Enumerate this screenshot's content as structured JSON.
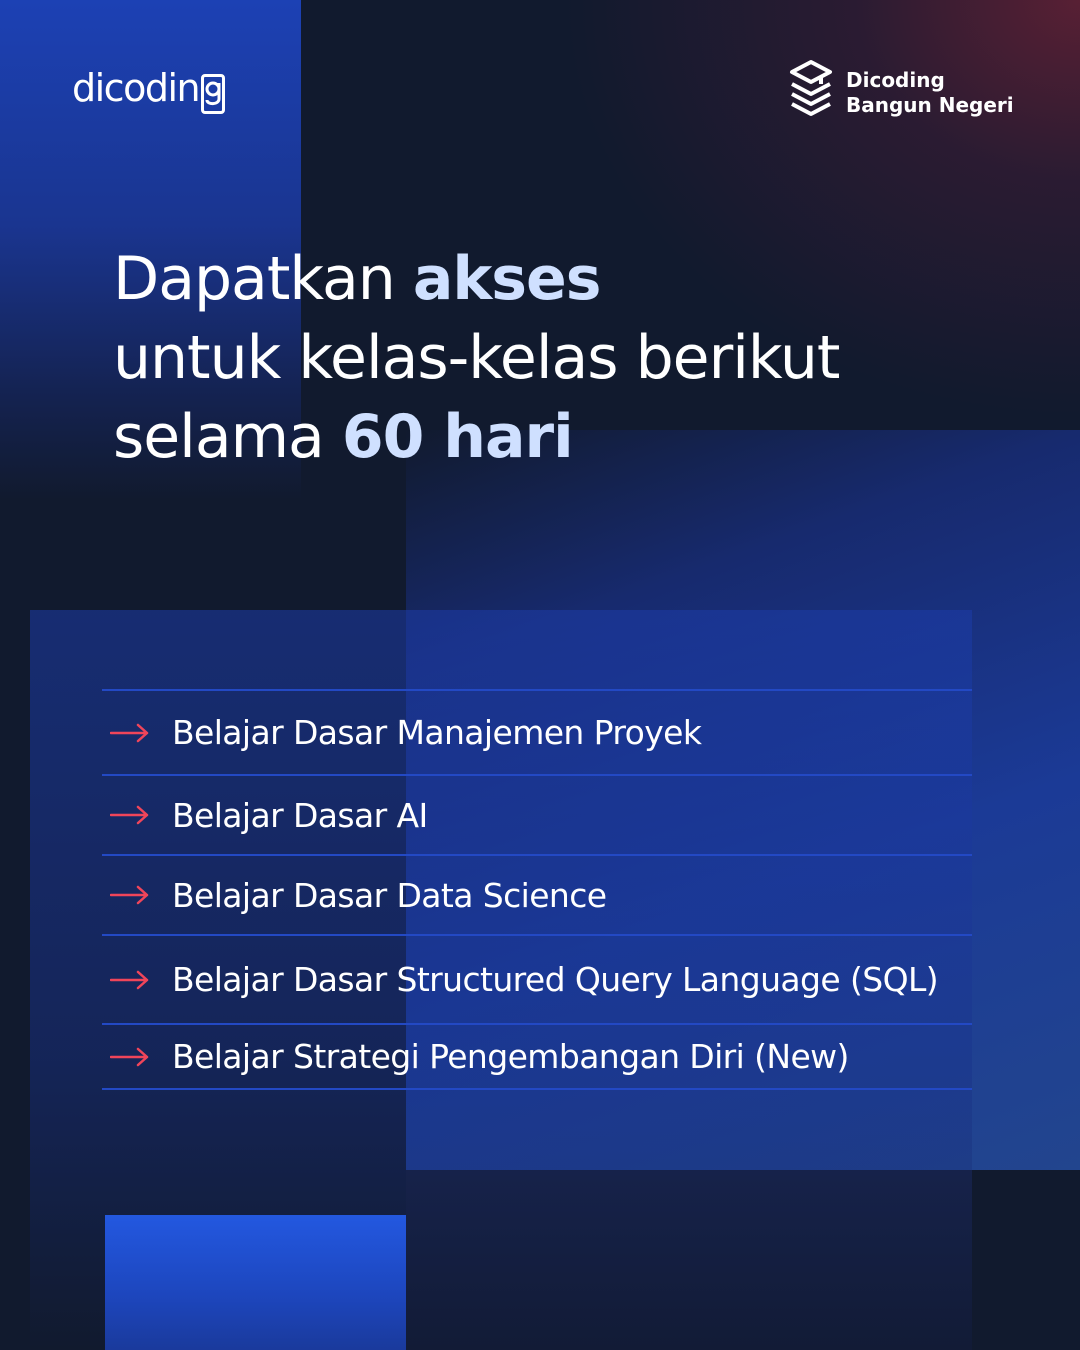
{
  "header": {
    "logo_text": "dicodin",
    "brand_line1": "Dicoding",
    "brand_line2": "Bangun Negeri"
  },
  "headline": {
    "line1_normal": "Dapatkan ",
    "line1_highlight": "akses",
    "line2": "untuk kelas-kelas berikut",
    "line3_normal": "selama ",
    "line3_highlight": "60 hari"
  },
  "courses": [
    "Belajar Dasar Manajemen Proyek",
    "Belajar Dasar AI",
    "Belajar Dasar Data Science",
    "Belajar Dasar Structured Query Language (SQL)",
    "Belajar Strategi Pengembangan Diri (New)"
  ],
  "colors": {
    "background": "#111a2e",
    "accent_blue": "#1c41b4",
    "highlight_text": "#cfe0ff",
    "arrow": "#f0455a",
    "divider": "#2349c4"
  },
  "icons": {
    "logo": "dicoding-logo",
    "brand": "layered-stack-icon",
    "bullet": "arrow-right-icon"
  }
}
